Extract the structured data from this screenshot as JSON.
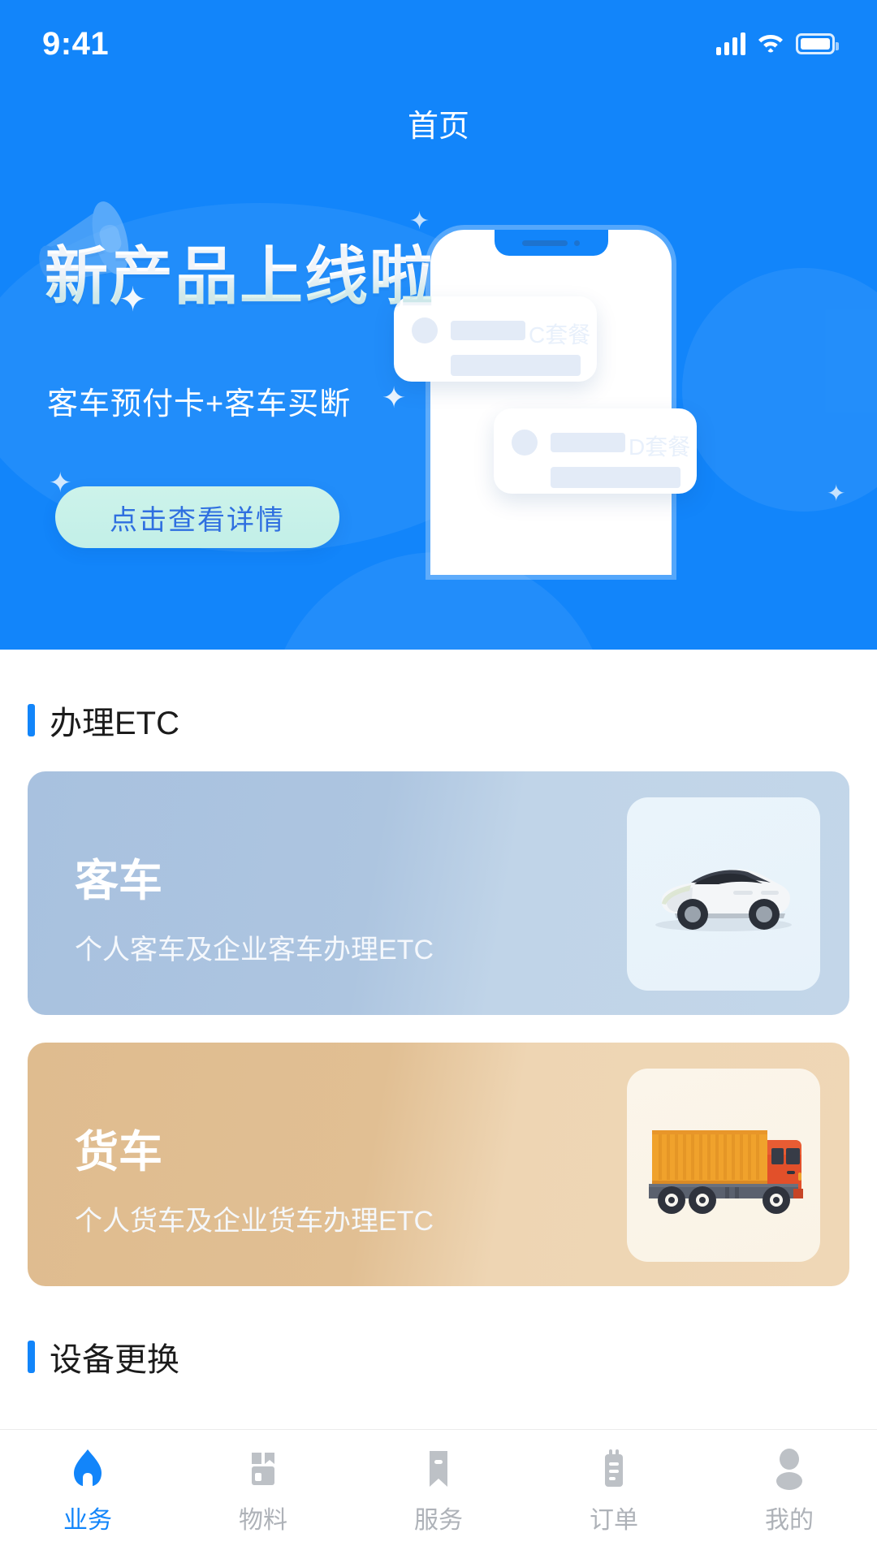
{
  "status_bar": {
    "time": "9:41",
    "signal_icon": "signal-bars-icon",
    "wifi_icon": "wifi-icon",
    "battery_icon": "battery-icon"
  },
  "header": {
    "title": "首页"
  },
  "banner": {
    "heading": "新产品上线啦",
    "subtitle": "客车预付卡+客车买断",
    "cta_label": "点击查看详情",
    "megaphone_icon": "megaphone-icon",
    "phone_mock": {
      "cards": [
        {
          "plan_label": "C套餐"
        },
        {
          "plan_label": "D套餐"
        }
      ]
    },
    "colors": {
      "background": "#1285FA",
      "cta_background": "#c7f0e8",
      "cta_text": "#2f6fe0"
    }
  },
  "sections": [
    {
      "title": "办理ETC",
      "accent_color": "#1285FA",
      "cards": [
        {
          "title": "客车",
          "description": "个人客车及企业客车办理ETC",
          "icon": "car-icon",
          "background": "#b4cae1"
        },
        {
          "title": "货车",
          "description": "个人货车及企业货车办理ETC",
          "icon": "truck-icon",
          "background": "#e3c198"
        }
      ]
    },
    {
      "title": "设备更换",
      "accent_color": "#1285FA",
      "cards": []
    }
  ],
  "tabbar": {
    "items": [
      {
        "label": "业务",
        "icon": "home-icon",
        "active": true
      },
      {
        "label": "物料",
        "icon": "box-icon",
        "active": false
      },
      {
        "label": "服务",
        "icon": "bookmark-icon",
        "active": false
      },
      {
        "label": "订单",
        "icon": "clipboard-icon",
        "active": false
      },
      {
        "label": "我的",
        "icon": "person-icon",
        "active": false
      }
    ],
    "active_color": "#1285FA",
    "inactive_color": "#aeb2b8"
  }
}
